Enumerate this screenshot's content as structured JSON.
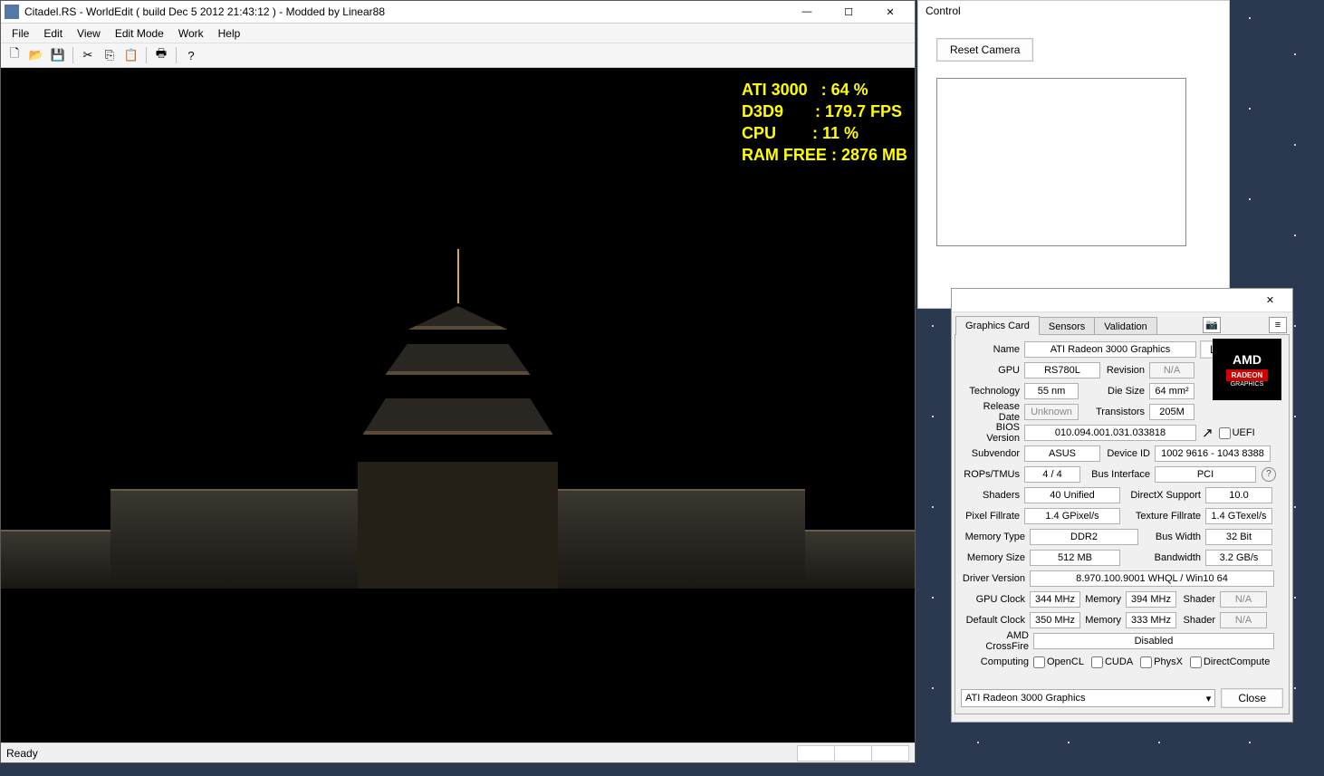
{
  "worldedit": {
    "title": "Citadel.RS - WorldEdit ( build Dec  5 2012 21:43:12 ) - Modded by Linear88",
    "menu": [
      "File",
      "Edit",
      "View",
      "Edit Mode",
      "Work",
      "Help"
    ],
    "status": "Ready",
    "overlay": {
      "l1a": "ATI 3000",
      "l1b": ": 64 %",
      "l2a": "D3D9",
      "l2b": ": 179.7 FPS",
      "l3a": "CPU",
      "l3b": ": 11 %",
      "l4a": "RAM FREE",
      "l4b": ": 2876 MB"
    },
    "win_min": "—",
    "win_max": "☐",
    "win_close": "✕"
  },
  "control": {
    "title": "Control",
    "reset": "Reset Camera"
  },
  "gpuz": {
    "tabs": [
      "Graphics Card",
      "Sensors",
      "Validation"
    ],
    "lookup": "Lookup",
    "close": "Close",
    "win_close": "✕",
    "labels": {
      "name": "Name",
      "gpu": "GPU",
      "revision": "Revision",
      "tech": "Technology",
      "die": "Die Size",
      "rel": "Release Date",
      "trans": "Transistors",
      "bios": "BIOS Version",
      "uefi": "UEFI",
      "subv": "Subvendor",
      "devid": "Device ID",
      "rops": "ROPs/TMUs",
      "bus": "Bus Interface",
      "shaders": "Shaders",
      "dx": "DirectX Support",
      "pfill": "Pixel Fillrate",
      "tfill": "Texture Fillrate",
      "memtype": "Memory Type",
      "buswidth": "Bus Width",
      "memsize": "Memory Size",
      "bw": "Bandwidth",
      "drv": "Driver Version",
      "gclk": "GPU Clock",
      "mem": "Memory",
      "shd": "Shader",
      "dclk": "Default Clock",
      "cf": "AMD CrossFire",
      "comp": "Computing",
      "opencl": "OpenCL",
      "cuda": "CUDA",
      "physx": "PhysX",
      "dcomp": "DirectCompute"
    },
    "fields": {
      "name": "ATI Radeon 3000 Graphics",
      "gpu": "RS780L",
      "revision": "N/A",
      "tech": "55 nm",
      "die": "64 mm²",
      "rel": "Unknown",
      "trans": "205M",
      "bios": "010.094.001.031.033818",
      "subv": "ASUS",
      "devid": "1002 9616 - 1043 8388",
      "rops": "4 / 4",
      "bus": "PCI",
      "shaders": "40 Unified",
      "dx": "10.0",
      "pfill": "1.4 GPixel/s",
      "tfill": "1.4 GTexel/s",
      "memtype": "DDR2",
      "buswidth": "32 Bit",
      "memsize": "512 MB",
      "bw": "3.2 GB/s",
      "drv": "8.970.100.9001 WHQL / Win10 64",
      "gclk": "344 MHz",
      "gmem": "394 MHz",
      "gshd": "N/A",
      "dclk": "350 MHz",
      "dmem": "333 MHz",
      "dshd": "N/A",
      "cf": "Disabled",
      "amd": "AMD",
      "rad": "RADEON"
    },
    "selector": "ATI Radeon 3000 Graphics"
  }
}
